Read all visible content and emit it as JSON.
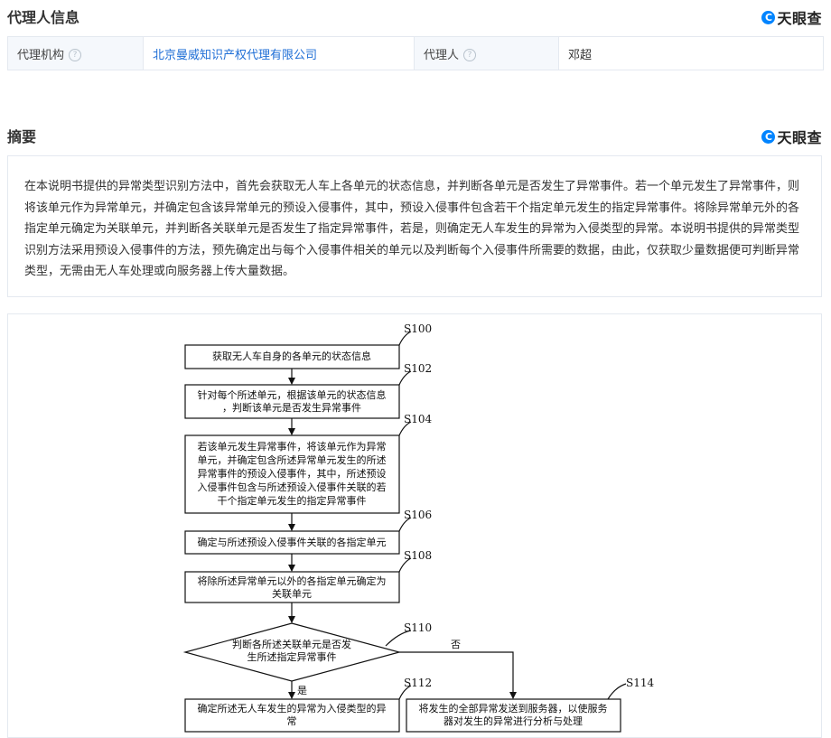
{
  "agent_section": {
    "title": "代理人信息",
    "brand": "天眼查",
    "agency_label": "代理机构",
    "agency_value": "北京曼威知识产权代理有限公司",
    "agent_label": "代理人",
    "agent_value": "邓超",
    "help_icon": "?"
  },
  "abstract_section": {
    "title": "摘要",
    "brand": "天眼查",
    "text": "在本说明书提供的异常类型识别方法中，首先会获取无人车上各单元的状态信息，并判断各单元是否发生了异常事件。若一个单元发生了异常事件，则将该单元作为异常单元，并确定包含该异常单元的预设入侵事件，其中，预设入侵事件包含若干个指定单元发生的指定异常事件。将除异常单元外的各指定单元确定为关联单元，并判断各关联单元是否发生了指定异常事件，若是，则确定无人车发生的异常为入侵类型的异常。本说明书提供的异常类型识别方法采用预设入侵事件的方法，预先确定出与每个入侵事件相关的单元以及判断每个入侵事件所需要的数据，由此，仅获取少量数据便可判断异常类型，无需由无人车处理或向服务器上传大量数据。"
  },
  "flowchart": {
    "steps": [
      {
        "id": "S100",
        "lines": [
          "获取无人车自身的各单元的状态信息"
        ]
      },
      {
        "id": "S102",
        "lines": [
          "针对每个所述单元，根据该单元的状态信息",
          "，判断该单元是否发生异常事件"
        ]
      },
      {
        "id": "S104",
        "lines": [
          "若该单元发生异常事件，将该单元作为异常",
          "单元，并确定包含所述异常单元发生的所述",
          "异常事件的预设入侵事件，其中，所述预设",
          "入侵事件包含与所述预设入侵事件关联的若",
          "干个指定单元发生的指定异常事件"
        ]
      },
      {
        "id": "S106",
        "lines": [
          "确定与所述预设入侵事件关联的各指定单元"
        ]
      },
      {
        "id": "S108",
        "lines": [
          "将除所述异常单元以外的各指定单元确定为",
          "关联单元"
        ]
      },
      {
        "id": "S110",
        "lines": [
          "判断各所述关联单元是否发",
          "生所述指定异常事件"
        ]
      },
      {
        "id": "S112",
        "lines": [
          "确定所述无人车发生的异常为入侵类型的异",
          "常"
        ]
      },
      {
        "id": "S114",
        "lines": [
          "将发生的全部异常发送到服务器，以使服务",
          "器对发生的异常进行分析与处理"
        ]
      }
    ],
    "yes_label": "是",
    "no_label": "否"
  }
}
